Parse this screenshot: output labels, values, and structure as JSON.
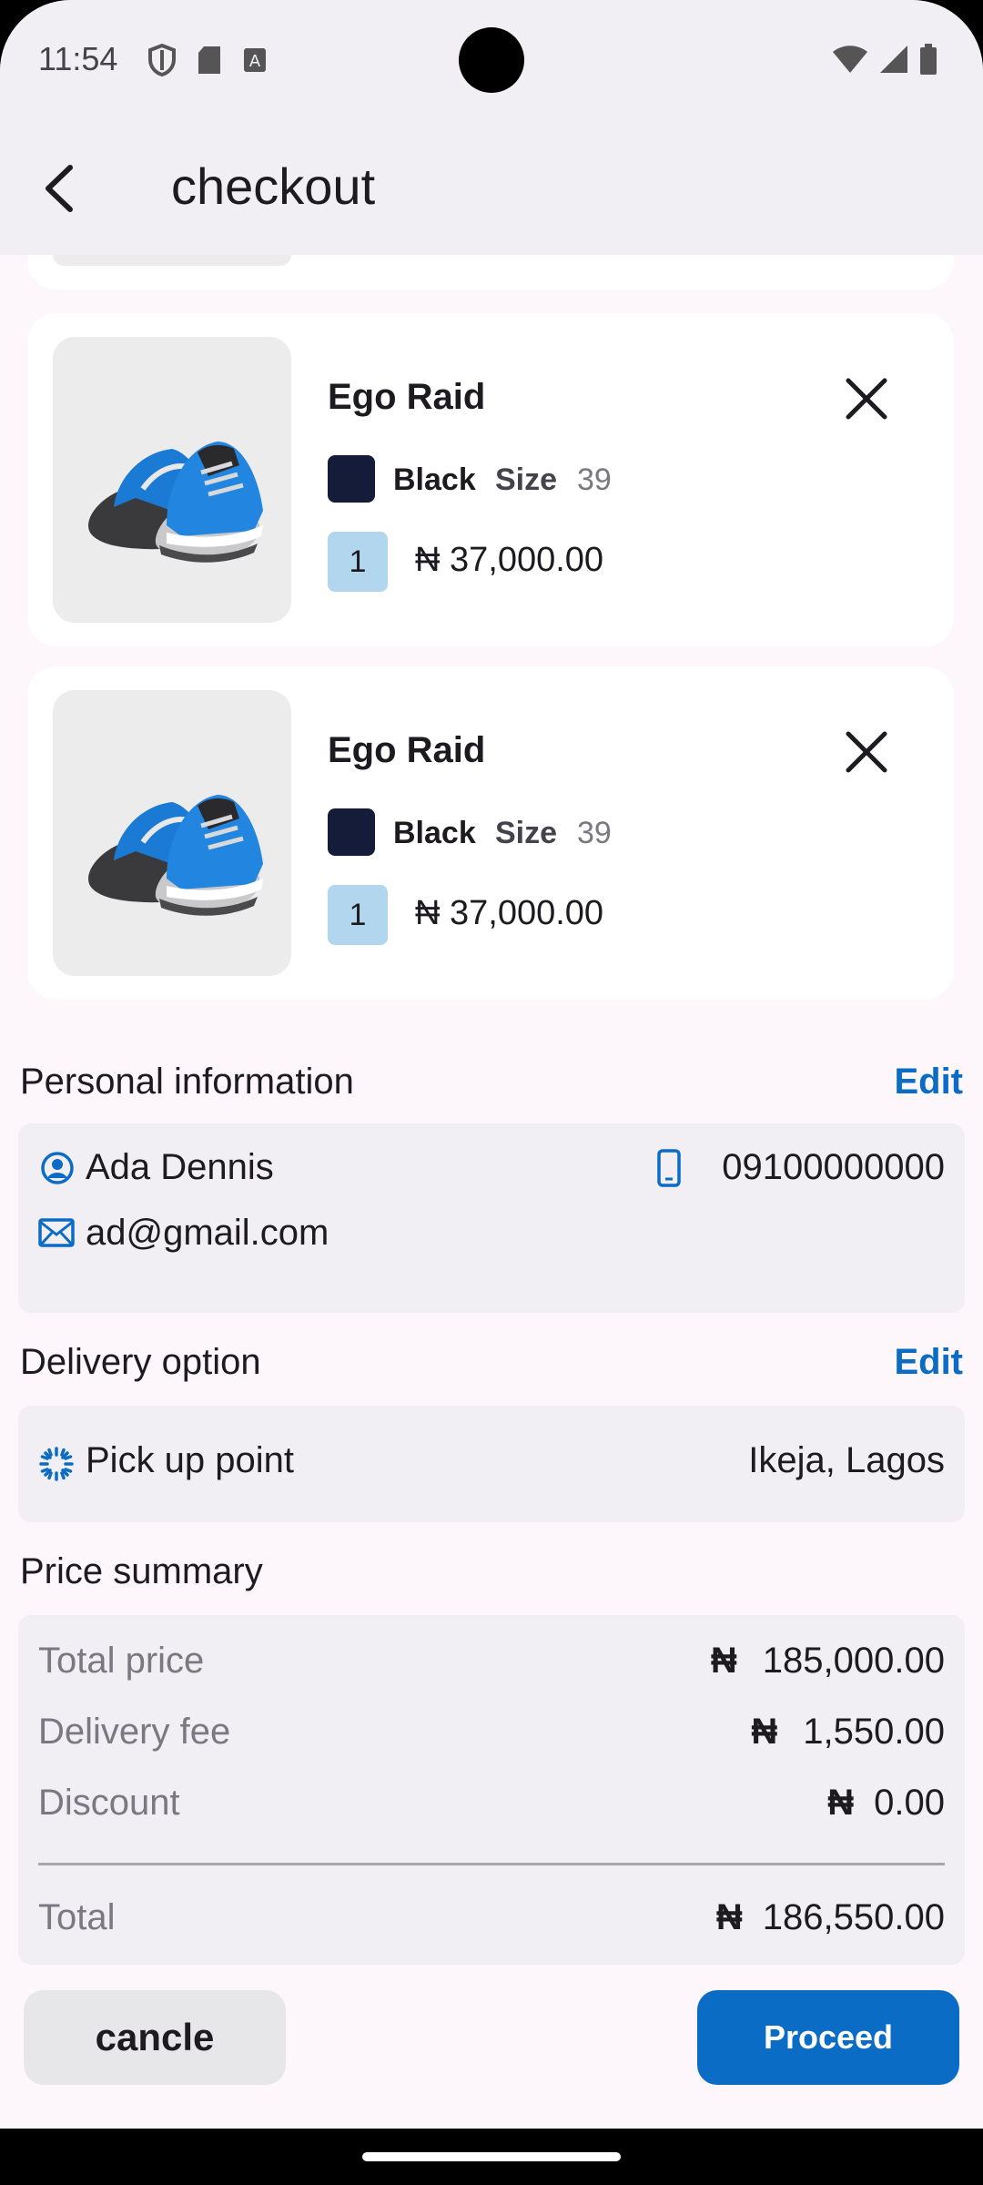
{
  "status_bar": {
    "time": "11:54"
  },
  "app_bar": {
    "title": "checkout"
  },
  "cart_items": [
    {
      "name": "Ego Raid",
      "color": "Black",
      "size_label": "Size",
      "size": "39",
      "quantity": "1",
      "price": "₦ 37,000.00"
    },
    {
      "name": "Ego Raid",
      "color": "Black",
      "size_label": "Size",
      "size": "39",
      "quantity": "1",
      "price": "₦ 37,000.00"
    }
  ],
  "personal_info": {
    "title": "Personal information",
    "edit_label": "Edit",
    "name": "Ada Dennis",
    "phone": "09100000000",
    "email": "ad@gmail.com"
  },
  "delivery": {
    "title": "Delivery option",
    "edit_label": "Edit",
    "option": "Pick up point",
    "location": "Ikeja, Lagos"
  },
  "price_summary": {
    "title": "Price summary",
    "currency": "₦",
    "total_price_label": "Total price",
    "total_price": "185,000.00",
    "delivery_fee_label": "Delivery fee",
    "delivery_fee": "1,550.00",
    "discount_label": "Discount",
    "discount": "0.00",
    "total_label": "Total",
    "total": "186,550.00"
  },
  "actions": {
    "cancel_label": "cancle",
    "proceed_label": "Proceed"
  },
  "colors": {
    "accent": "#0b6cc5",
    "swatch": "#141c3a",
    "qty_badge": "#b3d6ef"
  }
}
